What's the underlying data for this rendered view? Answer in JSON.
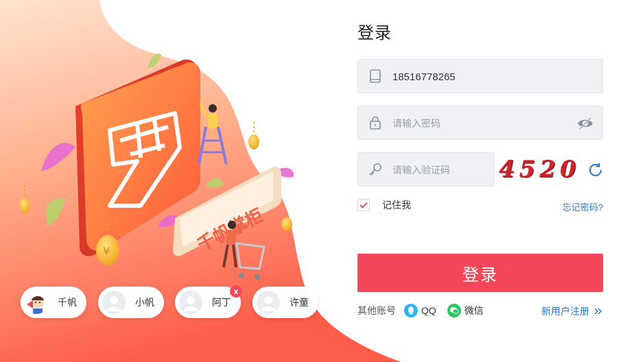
{
  "form": {
    "title": "登录",
    "phone": {
      "value": "18516778265"
    },
    "password": {
      "placeholder": "请输入密码"
    },
    "captcha_input": {
      "placeholder": "请输入验证码"
    },
    "captcha_code": "4520",
    "remember_label": "记住我",
    "remember_checked": true,
    "forgot_label": "忘记密码?",
    "login_label": "登录",
    "other_accounts_label": "其他账号",
    "qq_label": "QQ",
    "wechat_label": "微信",
    "register_label": "新用户注册"
  },
  "brand": {
    "sign_text": "千帆掌柜"
  },
  "recent_accounts": [
    {
      "name": "千帆"
    },
    {
      "name": "小帆"
    },
    {
      "name": "阿丁",
      "remove_label": "x"
    },
    {
      "name": "许童"
    }
  ],
  "colors": {
    "primary": "#f5475a",
    "link": "#1f78c8",
    "field_bg": "#f0f1f5",
    "hero_gradient_top": "#ffd3b3",
    "hero_gradient_bottom": "#fd6a51",
    "qq": "#2bb6f3",
    "wechat": "#2cc664"
  },
  "icons": {
    "phone": "phone-icon",
    "lock": "lock-icon",
    "eye": "eye-hidden-icon",
    "key": "key-icon",
    "refresh": "refresh-icon",
    "check": "check-icon",
    "qq": "qq-icon",
    "wechat": "wechat-icon",
    "chevron": "double-chevron-right-icon"
  }
}
